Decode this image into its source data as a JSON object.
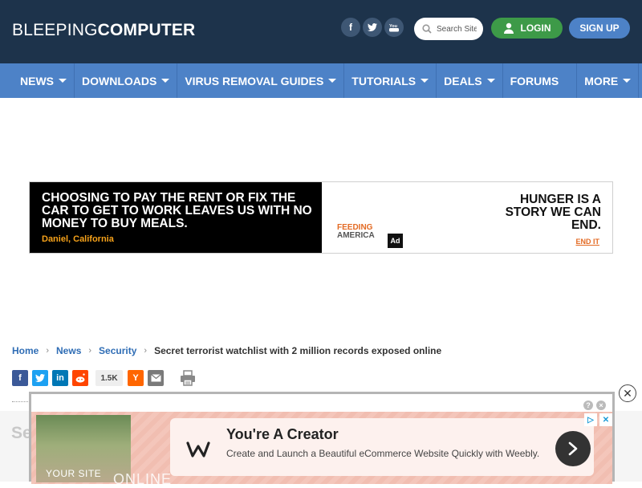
{
  "header": {
    "logo_part1": "BLEEPING",
    "logo_part2": "COMPUTER",
    "social": [
      "facebook-icon",
      "twitter-icon",
      "youtube-icon"
    ],
    "search_placeholder": "Search Site",
    "login_label": "LOGIN",
    "signup_label": "SIGN UP"
  },
  "nav": {
    "items": [
      {
        "label": "NEWS",
        "dropdown": true
      },
      {
        "label": "DOWNLOADS",
        "dropdown": true
      },
      {
        "label": "VIRUS REMOVAL GUIDES",
        "dropdown": true
      },
      {
        "label": "TUTORIALS",
        "dropdown": true
      },
      {
        "label": "DEALS",
        "dropdown": true
      },
      {
        "label": "FORUMS",
        "dropdown": false
      },
      {
        "label": "MORE",
        "dropdown": true
      }
    ]
  },
  "ad_banner": {
    "headline": "CHOOSING TO PAY THE RENT OR FIX THE CAR TO GET TO WORK LEAVES US WITH NO MONEY TO BUY MEALS.",
    "location": "Daniel, California",
    "brand_line1": "FEEDING",
    "brand_line2": "AMERICA",
    "ad_council": "Ad",
    "right_headline": "HUNGER IS A STORY WE CAN END.",
    "cta": "END IT"
  },
  "breadcrumb": {
    "home": "Home",
    "news": "News",
    "security": "Security",
    "current": "Secret terrorist watchlist with 2 million records exposed online"
  },
  "share": {
    "count": "1.5K"
  },
  "page_title_peek": "Se",
  "bottom_ad": {
    "photo_label": "YOUR SITE",
    "watermark": "ONLINE",
    "title": "You're A Creator",
    "description": "Create and Launch a Beautiful eCommerce Website Quickly with Weebly."
  },
  "colors": {
    "header_bg": "#1d334b",
    "nav_bg": "#4d82c7",
    "login_green": "#3d9a48",
    "link_blue": "#2f6db5"
  }
}
